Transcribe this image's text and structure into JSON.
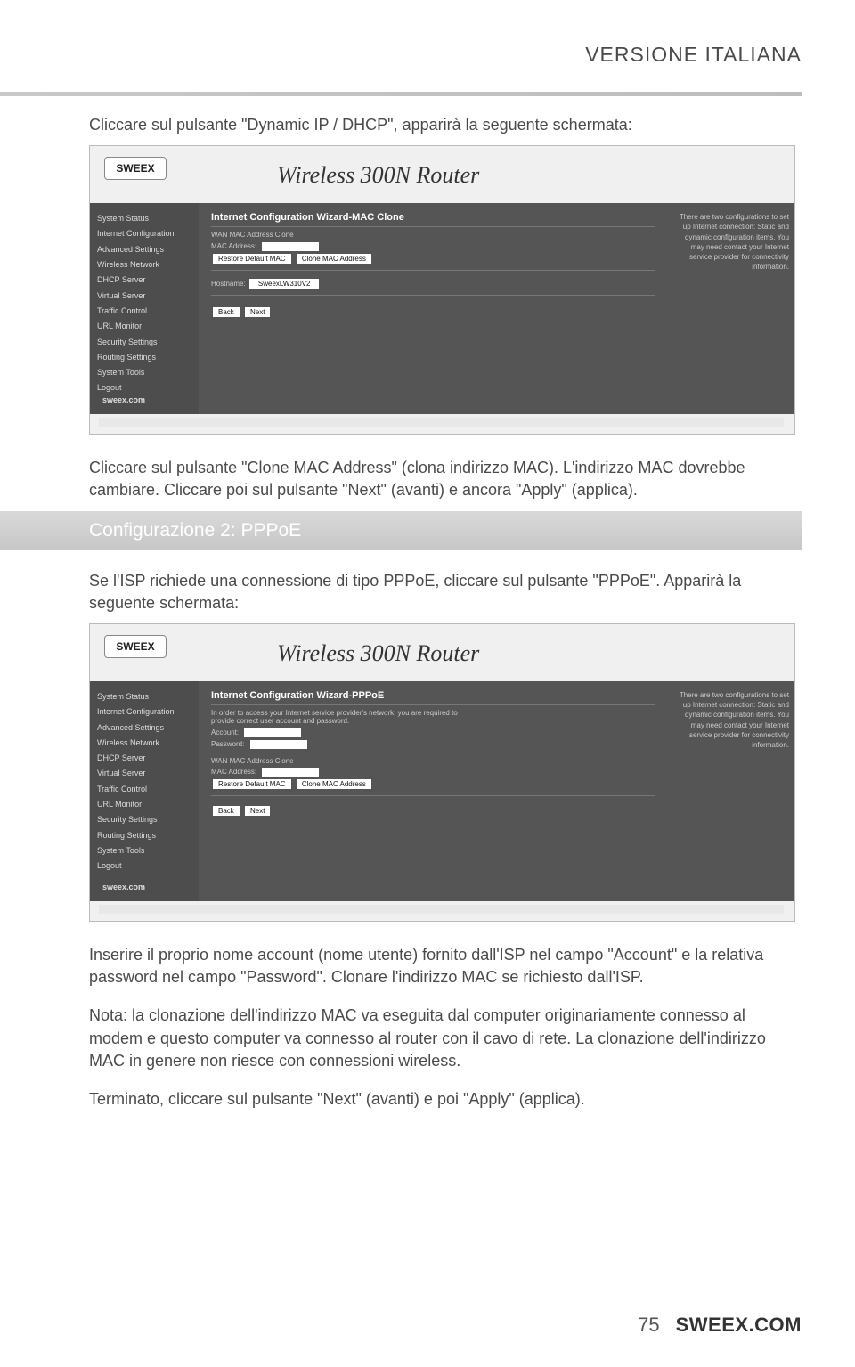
{
  "page": {
    "header_title": "VERSIONE ITALIANA",
    "intro1": "Cliccare sul pulsante \"Dynamic IP / DHCP\", apparirà la seguente schermata:",
    "after_sc1": "Cliccare sul pulsante \"Clone MAC Address\" (clona indirizzo MAC). L'indirizzo MAC dovrebbe cambiare. Cliccare poi sul pulsante \"Next\" (avanti) e ancora \"Apply\" (applica).",
    "section2_title": "Configurazione 2: PPPoE",
    "section2_text": "Se l'ISP richiede una connessione di tipo PPPoE, cliccare sul pulsante \"PPPoE\". Apparirà la seguente schermata:",
    "after_sc2_a": "Inserire il proprio nome account (nome utente) fornito dall'ISP nel campo \"Account\" e la relativa password nel campo \"Password\". Clonare l'indirizzo MAC se richiesto dall'ISP.",
    "after_sc2_b": "Nota: la clonazione dell'indirizzo MAC va eseguita dal computer originariamente connesso al modem e questo computer va connesso al router con il cavo di rete. La clonazione dell'indirizzo MAC in genere non riesce con connessioni wireless.",
    "after_sc2_c": "Terminato, cliccare sul pulsante \"Next\" (avanti) e poi \"Apply\" (applica).",
    "page_number": "75",
    "footer_brand": "SWEEX.COM"
  },
  "screenshot1": {
    "logo": "SWEEX",
    "title": "Wireless 300N Router",
    "panel_title": "Internet Configuration Wizard-MAC Clone",
    "sidebar": [
      "System Status",
      "Internet Configuration",
      "Advanced Settings",
      "Wireless Network",
      "DHCP Server",
      "Virtual Server",
      "Traffic Control",
      "URL Monitor",
      "Security Settings",
      "Routing Settings",
      "System Tools",
      "Logout"
    ],
    "sidebar_footer": "sweex.com",
    "labels": {
      "wan_clone": "WAN MAC Address Clone",
      "mac_addr": "MAC Address:",
      "restore": "Restore Default MAC",
      "clone": "Clone MAC Address",
      "hostname": "Hostname:",
      "hostval": "SweexLW310V2",
      "back": "Back",
      "next": "Next"
    },
    "help": "There are two configurations to set up Internet connection: Static and dynamic configuration items. You may need contact your Internet service provider for connectivity information."
  },
  "screenshot2": {
    "logo": "SWEEX",
    "title": "Wireless 300N Router",
    "panel_title": "Internet Configuration Wizard-PPPoE",
    "sidebar": [
      "System Status",
      "Internet Configuration",
      "Advanced Settings",
      "Wireless Network",
      "DHCP Server",
      "Virtual Server",
      "Traffic Control",
      "URL Monitor",
      "Security Settings",
      "Routing Settings",
      "System Tools",
      "Logout"
    ],
    "sidebar_footer": "sweex.com",
    "labels": {
      "intro": "In order to access your Internet service provider's network, you are required to provide correct user account and password.",
      "account": "Account:",
      "password": "Password:",
      "wan_clone": "WAN MAC Address Clone",
      "mac_addr": "MAC Address:",
      "restore": "Restore Default MAC",
      "clone": "Clone MAC Address",
      "back": "Back",
      "next": "Next"
    },
    "help": "There are two configurations to set up Internet connection: Static and dynamic configuration items. You may need contact your Internet service provider for connectivity information."
  }
}
